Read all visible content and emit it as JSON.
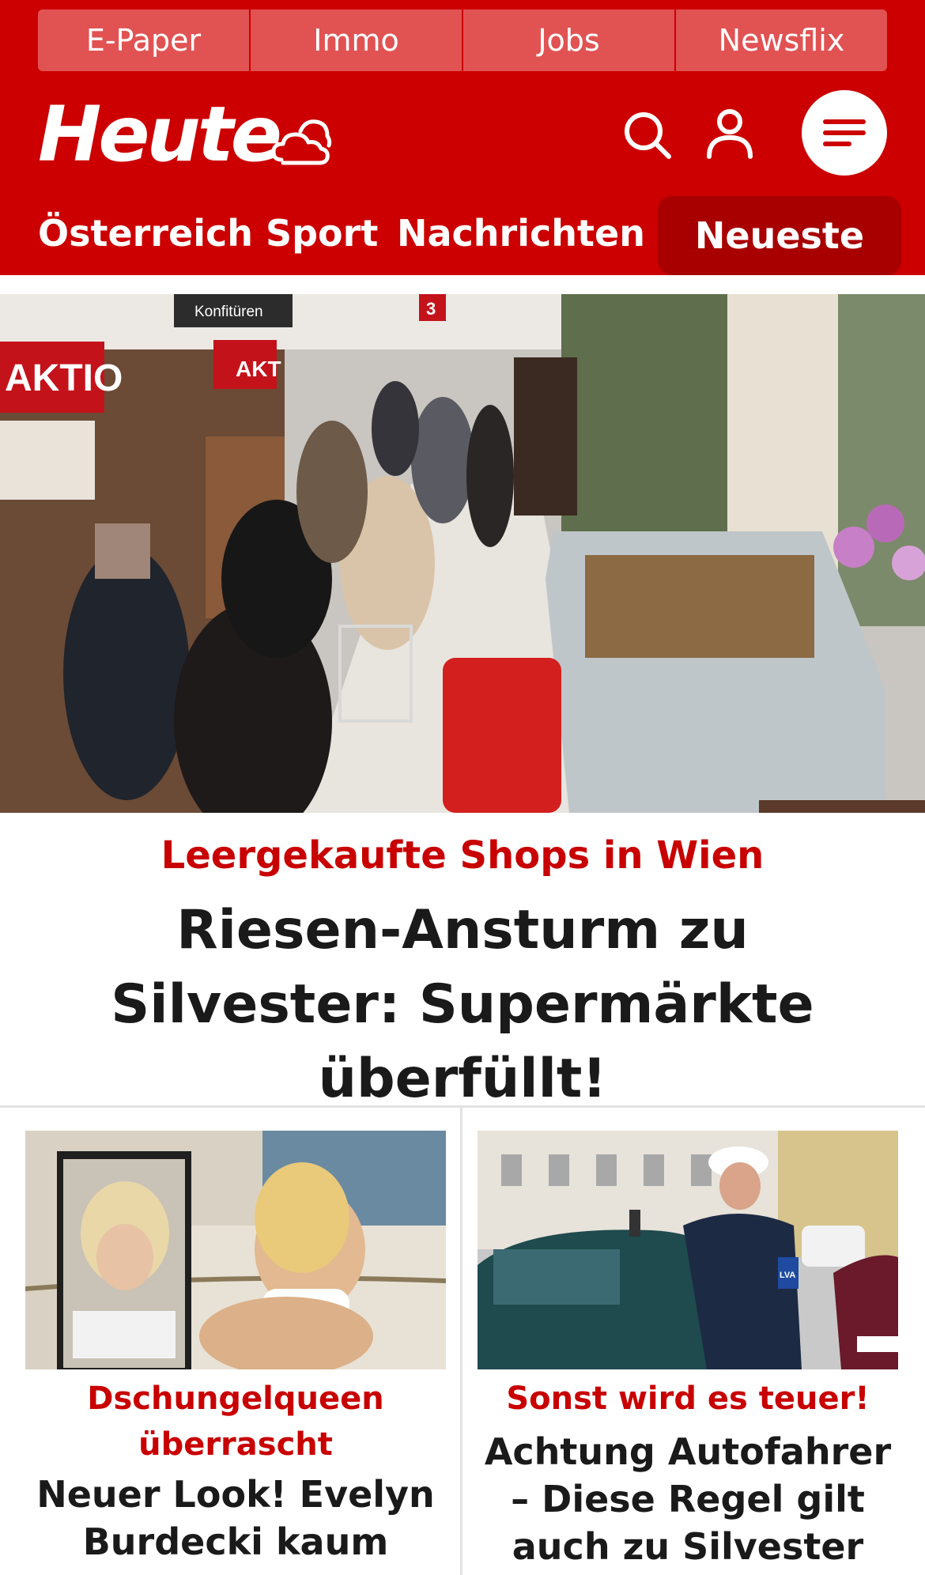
{
  "topnav": [
    "E-Paper",
    "Immo",
    "Jobs",
    "Newsflix"
  ],
  "brand": {
    "logo_text": "Heute"
  },
  "sections": [
    "Österreich",
    "Sport",
    "Nachrichten"
  ],
  "sections_active": "Neueste",
  "hero": {
    "kicker": "Leergekaufte Shops in Wien",
    "title": "Riesen-Ansturm zu Silvester: Supermärkte überfüllt!",
    "image_signs": [
      "AKTIO",
      "AKT",
      "Konfitüren",
      "3"
    ]
  },
  "cards": [
    {
      "kicker": "Dschungelqueen überrascht",
      "title": "Neuer Look! Evelyn Burdecki kaum"
    },
    {
      "kicker": "Sonst wird es teuer!",
      "title": "Achtung Autofahrer – Diese Regel gilt auch zu Silvester",
      "image_badge": "LVA"
    }
  ],
  "colors": {
    "brand_red": "#cc0000",
    "nav_light": "#e15353",
    "active_tab": "#a80000",
    "kicker_red": "#c80000"
  }
}
